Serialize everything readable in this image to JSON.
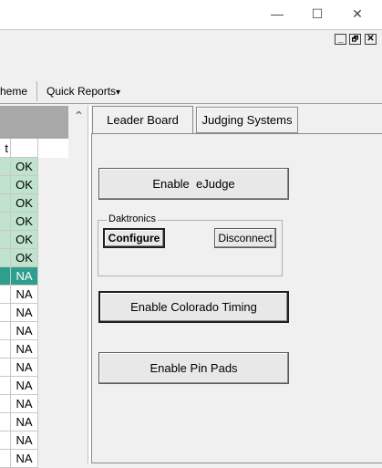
{
  "window": {
    "minimize_glyph": "—",
    "maximize_glyph": "☐",
    "close_glyph": "✕"
  },
  "mdi": {
    "minimize": "_",
    "restore": "🗗",
    "close": "✕"
  },
  "menu": {
    "theme": "heme",
    "quick_reports": "Quick Reports",
    "dropdown_glyph": "▾"
  },
  "grid": {
    "column_header": "t",
    "rows": [
      {
        "value": "OK",
        "status": "ok"
      },
      {
        "value": "OK",
        "status": "ok"
      },
      {
        "value": "OK",
        "status": "ok"
      },
      {
        "value": "OK",
        "status": "ok"
      },
      {
        "value": "OK",
        "status": "ok"
      },
      {
        "value": "OK",
        "status": "ok"
      },
      {
        "value": "NA",
        "status": "selected"
      },
      {
        "value": "NA",
        "status": "na"
      },
      {
        "value": "NA",
        "status": "na"
      },
      {
        "value": "NA",
        "status": "na"
      },
      {
        "value": "NA",
        "status": "na"
      },
      {
        "value": "NA",
        "status": "na"
      },
      {
        "value": "NA",
        "status": "na"
      },
      {
        "value": "NA",
        "status": "na"
      },
      {
        "value": "NA",
        "status": "na"
      },
      {
        "value": "NA",
        "status": "na"
      },
      {
        "value": "NA",
        "status": "na"
      }
    ]
  },
  "scroll": {
    "up_glyph": "⌃"
  },
  "tabs": [
    {
      "label": "Leader Board",
      "active": false
    },
    {
      "label": "Judging Systems",
      "active": true
    }
  ],
  "judging": {
    "enable_ejudge": "Enable  eJudge",
    "daktronics_label": "Daktronics",
    "configure": "Configure",
    "disconnect": "Disconnect",
    "enable_colorado": "Enable Colorado Timing",
    "enable_pinpads": "Enable Pin Pads"
  },
  "colors": {
    "ok_bg": "#bfe3cd",
    "selected_bg": "#2e9e8e",
    "na_bg": "#ffffff",
    "grid_header_bg": "#a8a8a8"
  }
}
